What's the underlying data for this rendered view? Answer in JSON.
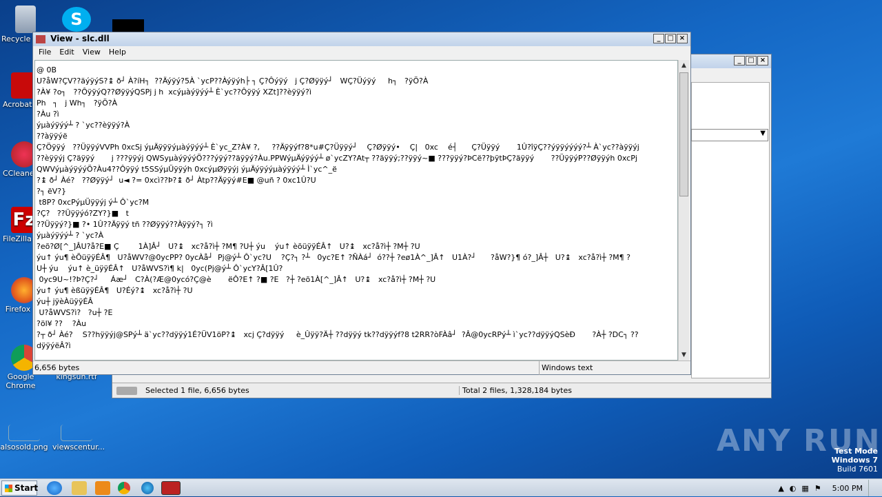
{
  "desktop": {
    "icons": [
      {
        "label": "Recycle Bin"
      },
      {
        "label": "Acrobat Reader DC"
      },
      {
        "label": "CCleaner"
      },
      {
        "label": "FileZilla Client"
      },
      {
        "label": "Firefox"
      },
      {
        "label": "Google Chrome"
      },
      {
        "label": "kingsun.rtf"
      },
      {
        "label": "alsosold.png"
      },
      {
        "label": "viewscentur..."
      }
    ],
    "watermark": "ANY RUN",
    "os_info": {
      "line1": "Test Mode",
      "line2": "Windows 7",
      "line3": "Build 7601"
    }
  },
  "viewer": {
    "title": "View - slc.dll",
    "menu": [
      "File",
      "Edit",
      "View",
      "Help"
    ],
    "top_partial": "@ 0B",
    "lines": [
      "U?åW?ÇV??äýÿýS?↨ ð┘ À?íH┐  ??Äýÿý?5À `ycP??Àýÿýh├ ┐ Ç?Ôýÿý   j Ç?Øÿÿý┘   WÇ?Üýÿý     h┐   ?ÿÖ?À",
      "?À¥ ?o┐   ??ÔÿÿýQ??ØÿÿýQSPj j h  xcýµàýÿýý┴ È`yc??Ôÿÿý XZt]??èÿÿý?ì",
      "Ph   ┐   j Wh┐   ?ÿÖ?À",
      "?Àu ?ì",
      "ýµàýÿýý┴ ? `yc??èÿÿý?À",
      "??àÿÿýë",
      "Ç?Öÿÿý   ??ÜÿÿýVVPh 0xcSj ýµÄÿÿÿýµàýÿýý┴ È`yc_Z?À¥ ?,     ??Äÿÿýf?8*u#Ç?Üÿÿý┘    Ç?Øÿÿý•    Ç|   0xc    é┤      Ç?Üÿÿý       1Û?îÿÇ??ýÿÿýýýý?┴ À`yc??àÿÿýj",
      "??èÿÿýj Ç?äÿÿý       j ???ÿÿýj QWSyµàýÿýýÖ???ýÿý??äÿÿý?Àu.PPWýµÄýÿýý┴ ø`ycZY?At┬ ??äÿÿý;??ÿÿý~■ ???ÿÿý?ÞCë??þÿtÞÇ?äÿÿý       ??ÜÿÿýP??Øÿÿýh 0xcPj",
      "QWVýµàýÿýýÖ?Àu4??Ôÿÿý t5SSýµÜÿÿýh 0xcýµØÿÿýj ýµÄýÿýýµàýÿýý┴ Ì`yc^_ë",
      "?↨ ð┘ Àé?   ??Øÿÿý┘  u◄ ?= 0xcì??Þ?↨ ð┘ Àtp??Äÿÿý#E■ @uñ ? 0xc1Û?U",
      "?┐ ëV?}",
      " t8P? 0xcPýµÜÿÿýj ý┴ Ô`yc?M",
      "?Ç?   ??Üÿÿýó?ZY?}■   t",
      "??Üÿÿý?}■ ?• 1Û??Äÿÿý tñ ??Øÿÿý??Àÿÿý?┐ ?ì",
      "ýµàýÿýý┴ ? `yc?À",
      "?eõ?Ø[^_]ÂU?å?E■ Ç        1À]Â┘   U?↨   xc?å?ì┼ ?M¶ ?U┼ ýu    ýu↑ èõüÿÿÉÂ↑   U?↨   xc?å?ì┼ ?M┼ ?U",
      "ýu↑ ýu¶ èÕüÿÿÉÂ¶   U?åWV?@0ycPP? 0ycÀå┘  Pj@ý┴ Ô`yc?U    ?Ç?┐ ?┴   0yc?E↑ ?ÑÀá┘  ó??┼ ?eø1À^_]Â↑   U1À?┘      ?åW?}¶ ó?_]Â┼   U?↨   xc?å?ì┼ ?M¶ ?",
      "U┼ ýu    ýu↑ è_üÿÿÉÂ↑   U?åWVS?ì¶ k|   0yc(Pj@ý┴ Ô`ycY?Â[1Û?",
      " 0yc9U~!?Þ?Ç?┘     Áæ┘   C?À(?Æ@0ycó?Ç@è       ëÔ?E↑ ?■ ?E   ?┼ ?eõ1À[^_]Â↑   U?↨   xc?å?ì┼ ?M┼ ?U",
      "ýu↑ ýu¶ èßüÿÿÉÂ¶   U?Éý?↨   xc?å?ì┼ ?U",
      "ýu┼ jÿèÀüÿÿÉÂ",
      " U?åWVS?ì?   ?u┼ ?E",
      "?öl¥ ??    ?Àu",
      "?┬ ð┘ Àé?    S??hÿÿýj@SPý┴ ä`yc??dÿÿý1É?ÜV1öP?↨   xcj Ç?dÿÿý     è_Ûÿÿ?Ä┼ ??dÿÿý tk??dÿÿýf?8 t2RR?òFÀâ┘  ?Â@0ycRPý┴ ì`yc??dÿÿýQSèÐ       ?À┼ ?DC┐ ??",
      "dÿÿýëÂ?ì"
    ],
    "status_left": "6,656 bytes",
    "status_right": "Windows text"
  },
  "background_window": {
    "status_selected": "Selected 1 file, 6,656 bytes",
    "status_total": "Total 2 files, 1,328,184 bytes"
  },
  "taskbar": {
    "start_label": "Start",
    "clock": "5:00 PM"
  }
}
